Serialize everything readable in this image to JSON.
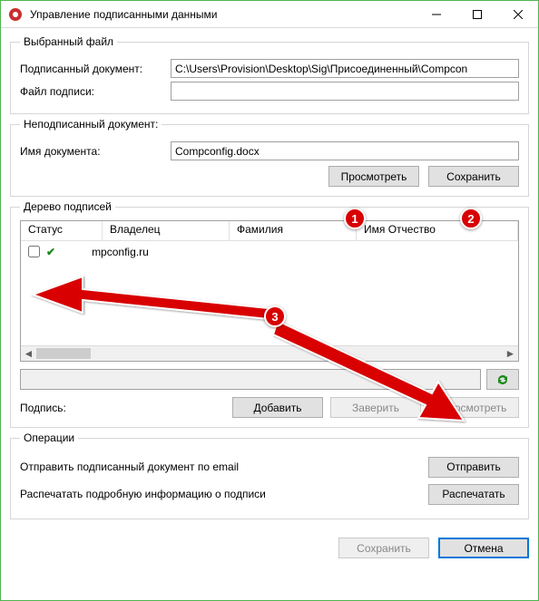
{
  "window": {
    "title": "Управление подписанными данными"
  },
  "selectedFile": {
    "legend": "Выбранный файл",
    "docLabel": "Подписанный документ:",
    "docValue": "C:\\Users\\Provision\\Desktop\\Sig\\Присоединенный\\Compcon",
    "sigLabel": "Файл подписи:",
    "sigValue": ""
  },
  "unsignedDoc": {
    "legend": "Неподписанный документ:",
    "nameLabel": "Имя документа:",
    "nameValue": "Compconfig.docx",
    "viewBtn": "Просмотреть",
    "saveBtn": "Сохранить"
  },
  "tree": {
    "legend": "Дерево подписей",
    "cols": {
      "status": "Статус",
      "owner": "Владелец",
      "surname": "Фамилия",
      "namepat": "Имя Отчество"
    },
    "item0": "mpconfig.ru",
    "pathInput": "",
    "sigLabel": "Подпись:",
    "addBtn": "Добавить",
    "certifyBtn": "Заверить",
    "viewBtn": "Просмотреть"
  },
  "ops": {
    "legend": "Операции",
    "sendLabel": "Отправить подписанный документ по email",
    "sendBtn": "Отправить",
    "printLabel": "Распечатать подробную информацию о подписи",
    "printBtn": "Распечатать"
  },
  "footer": {
    "saveBtn": "Сохранить",
    "cancelBtn": "Отмена"
  },
  "badges": {
    "b1": "1",
    "b2": "2",
    "b3": "3"
  }
}
